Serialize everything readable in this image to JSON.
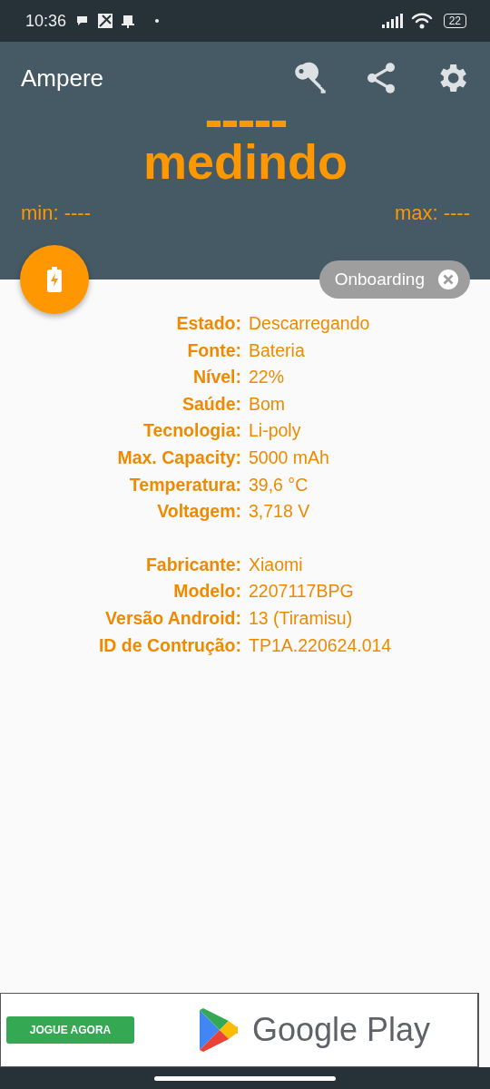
{
  "status_bar": {
    "time": "10:36",
    "battery": "22"
  },
  "toolbar": {
    "title": "Ampere"
  },
  "reading": {
    "value": "-----",
    "label": "medindo",
    "min": "min: ----",
    "max": "max: ----"
  },
  "chip": {
    "label": "Onboarding"
  },
  "groups": [
    {
      "rows": [
        {
          "label": "Estado:",
          "value": "Descarregando"
        },
        {
          "label": "Fonte:",
          "value": "Bateria"
        },
        {
          "label": "Nível:",
          "value": "22%"
        },
        {
          "label": "Saúde:",
          "value": "Bom"
        },
        {
          "label": "Tecnologia:",
          "value": "Li-poly"
        },
        {
          "label": "Max. Capacity:",
          "value": "5000 mAh"
        },
        {
          "label": "Temperatura:",
          "value": "39,6 °C"
        },
        {
          "label": "Voltagem:",
          "value": "3,718 V"
        }
      ]
    },
    {
      "rows": [
        {
          "label": "Fabricante:",
          "value": "Xiaomi"
        },
        {
          "label": "Modelo:",
          "value": "2207117BPG"
        },
        {
          "label": "Versão Android:",
          "value": "13 (Tiramisu)"
        },
        {
          "label": "ID de Contrução:",
          "value": "TP1A.220624.014"
        }
      ]
    }
  ],
  "ad": {
    "button": "JOGUE AGORA",
    "brand": "Google Play"
  }
}
